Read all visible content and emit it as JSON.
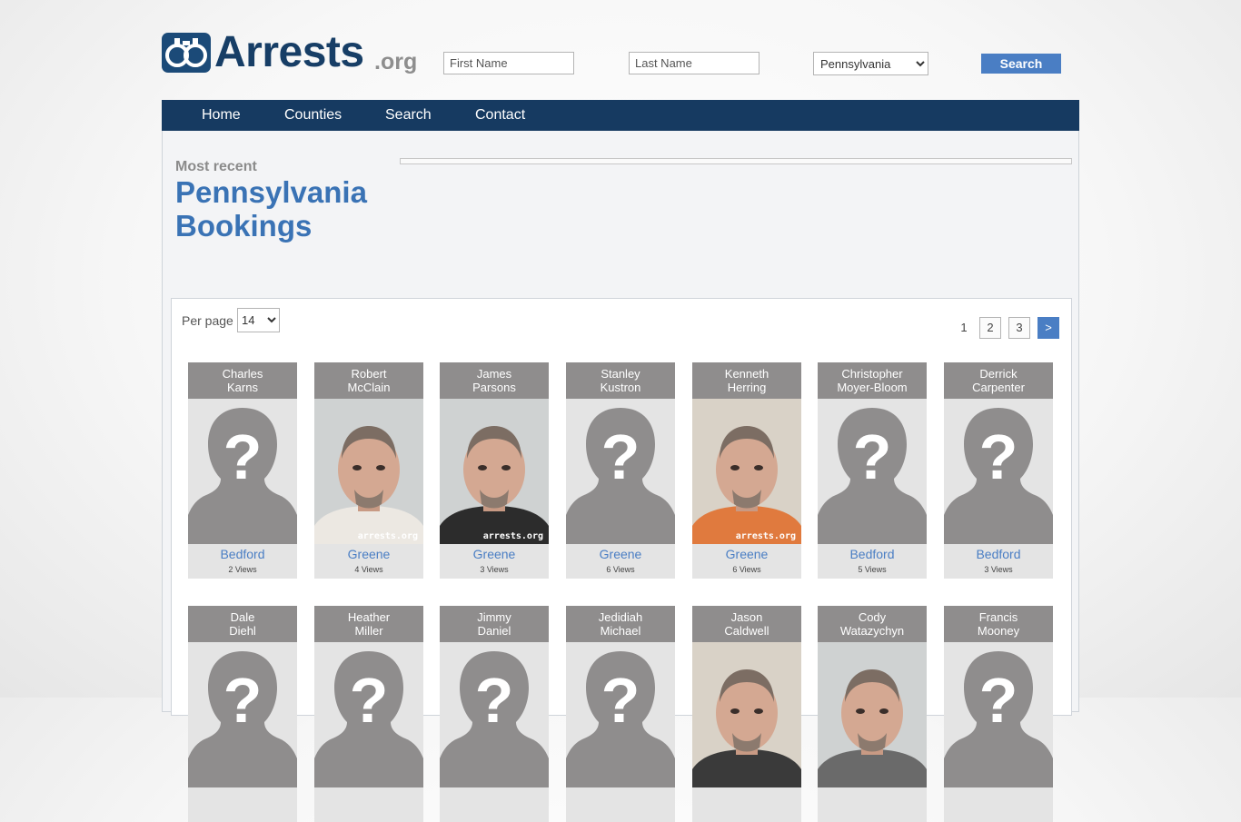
{
  "header": {
    "logo_text": "Arrests",
    "logo_tld": ".org",
    "first_name_placeholder": "First Name",
    "last_name_placeholder": "Last Name",
    "state_selected": "Pennsylvania",
    "search_label": "Search"
  },
  "nav": {
    "items": [
      {
        "label": "Home"
      },
      {
        "label": "Counties"
      },
      {
        "label": "Search"
      },
      {
        "label": "Contact"
      }
    ]
  },
  "main": {
    "subtitle": "Most recent",
    "title": "Pennsylvania Bookings"
  },
  "listing": {
    "per_page_label": "Per page",
    "per_page_value": "14",
    "pagination": {
      "current": "1",
      "pages": [
        "2",
        "3"
      ],
      "next": ">"
    }
  },
  "bookings": [
    {
      "first": "Charles",
      "last": "Karns",
      "county": "Bedford",
      "views": "2 Views",
      "photo": "placeholder"
    },
    {
      "first": "Robert",
      "last": "McClain",
      "county": "Greene",
      "views": "4 Views",
      "photo": "mugshot",
      "watermark": "arrests.org"
    },
    {
      "first": "James",
      "last": "Parsons",
      "county": "Greene",
      "views": "3 Views",
      "photo": "mugshot",
      "watermark": "arrests.org"
    },
    {
      "first": "Stanley",
      "last": "Kustron",
      "county": "Greene",
      "views": "6 Views",
      "photo": "placeholder"
    },
    {
      "first": "Kenneth",
      "last": "Herring",
      "county": "Greene",
      "views": "6 Views",
      "photo": "mugshot",
      "watermark": "arrests.org"
    },
    {
      "first": "Christopher",
      "last": "Moyer-Bloom",
      "county": "Bedford",
      "views": "5 Views",
      "photo": "placeholder"
    },
    {
      "first": "Derrick",
      "last": "Carpenter",
      "county": "Bedford",
      "views": "3 Views",
      "photo": "placeholder"
    },
    {
      "first": "Dale",
      "last": "Diehl",
      "county": "",
      "views": "",
      "photo": "placeholder"
    },
    {
      "first": "Heather",
      "last": "Miller",
      "county": "",
      "views": "",
      "photo": "placeholder"
    },
    {
      "first": "Jimmy",
      "last": "Daniel",
      "county": "",
      "views": "",
      "photo": "placeholder"
    },
    {
      "first": "Jedidiah",
      "last": "Michael",
      "county": "",
      "views": "",
      "photo": "placeholder"
    },
    {
      "first": "Jason",
      "last": "Caldwell",
      "county": "",
      "views": "",
      "photo": "mugshot"
    },
    {
      "first": "Cody",
      "last": "Watazychyn",
      "county": "",
      "views": "",
      "photo": "mugshot"
    },
    {
      "first": "Francis",
      "last": "Mooney",
      "county": "",
      "views": "",
      "photo": "placeholder"
    }
  ],
  "colors": {
    "brand_navy": "#163a61",
    "accent_blue": "#4a7ec4",
    "title_blue": "#3a73b5",
    "card_header_gray": "#8f8d8d"
  }
}
